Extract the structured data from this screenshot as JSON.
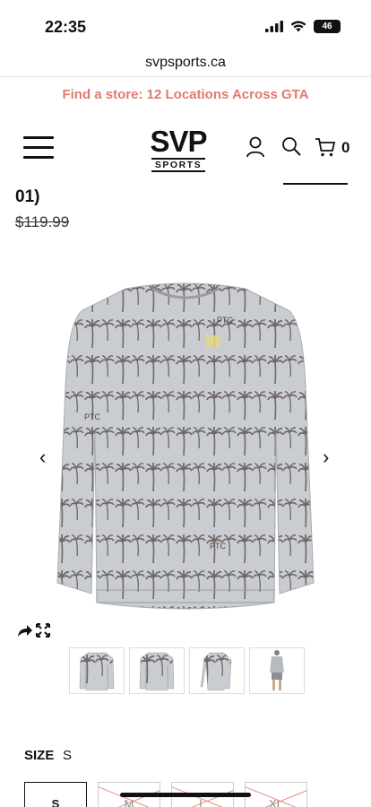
{
  "status_bar": {
    "time": "22:35",
    "battery": "46"
  },
  "browser": {
    "url": "svpsports.ca"
  },
  "promo": {
    "text": "Find a store: 12 Locations Across GTA"
  },
  "header": {
    "logo_main": "SVP",
    "logo_sub": "SPORTS",
    "cart_count": "0",
    "icons": [
      "menu-icon",
      "user-icon",
      "search-icon",
      "cart-icon"
    ]
  },
  "product": {
    "title_fragment": "01)",
    "price_original": "$119.99",
    "image_marks": [
      "PTC",
      "PTC",
      "PTC"
    ],
    "thumbnails": [
      "front",
      "back",
      "side",
      "model"
    ]
  },
  "size": {
    "label": "SIZE",
    "selected": "S",
    "options": [
      {
        "label": "S",
        "available": true
      },
      {
        "label": "M",
        "available": false
      },
      {
        "label": "L",
        "available": false
      },
      {
        "label": "XL",
        "available": false
      }
    ]
  },
  "colors": {
    "promo": "#e07a6f",
    "print_bg": "#c9ccd1",
    "print_fg": "#6f6866"
  }
}
